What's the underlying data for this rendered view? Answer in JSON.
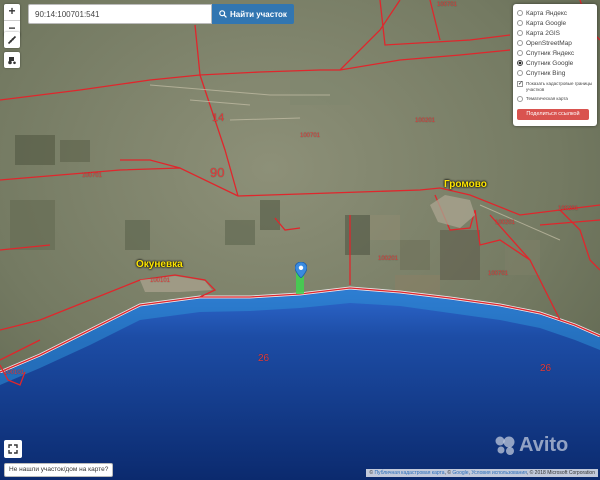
{
  "search": {
    "value": "90:14:100701:541",
    "button_label": "Найти участок"
  },
  "zoom": {
    "in_label": "+",
    "out_label": "−"
  },
  "layers": {
    "options": [
      "Карта Яндекс",
      "Карта Google",
      "Карта 2GIS",
      "OpenStreetMap",
      "Спутник Яндекс",
      "Спутник Google",
      "Спутник Bing"
    ],
    "selected": "Спутник Google",
    "show_boundaries_label": "Показать кадастровые границы участков",
    "thematic_label": "Тематическая карта",
    "share_label": "Поделиться ссылкой"
  },
  "not_found_label": "Не нашли участок/дом на карте?",
  "attribution": {
    "link1": "Публичная кадастровая карта",
    "google": "Google",
    "terms": "Условия использования",
    "copyright": "© 2018 Microsoft Corporation"
  },
  "watermark": "Avito",
  "places": {
    "okunevka": "Окуневка",
    "gromovo": "Громово"
  },
  "parcel_labels": {
    "l14": "14",
    "l90": "90",
    "l26a": "26",
    "l26b": "26",
    "a": "100701",
    "b": "100701",
    "c": "100201",
    "d": "100201",
    "e": "100701",
    "f": "100201",
    "g": "100701",
    "h": "100101",
    "i": "100201",
    "j": "100101"
  },
  "colors": {
    "parcel_border": "#e0262c",
    "coast": "#e8e8e8",
    "sea_shallow": "#2f6ad0",
    "sea_deep": "#0b2a6e",
    "land": "#7a806a",
    "place_label": "#ffe600",
    "marker": "#3a8be0",
    "parcel_fill": "#3fd44f"
  },
  "icons": {
    "search": "search-icon",
    "ruler": "ruler-icon",
    "tool": "tractor-icon",
    "fullscreen": "expand-icon",
    "marker": "map-marker-icon"
  }
}
